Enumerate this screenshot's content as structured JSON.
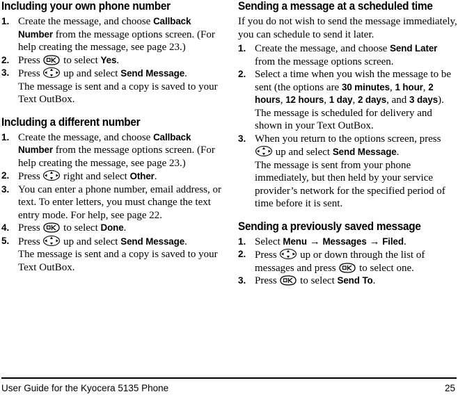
{
  "document": {
    "title": "User Guide for the Kyocera 5135 Phone",
    "page_number": "25"
  },
  "icons": {
    "ok_key": "ok-key-icon",
    "nav_key": "navigation-key-icon",
    "arrow": "→"
  },
  "left_column": {
    "section1": {
      "heading": "Including your own phone number",
      "steps": [
        {
          "num": "1.",
          "parts": [
            {
              "t": "Create the message, and choose ",
              "b": false
            },
            {
              "t": "Callback Number",
              "b": true
            },
            {
              "t": " from the message options screen. (For help creating the message, see page 23.)",
              "b": false
            }
          ]
        },
        {
          "num": "2.",
          "parts": [
            {
              "t": "Press ",
              "b": false
            },
            {
              "t": "",
              "icon": "ok"
            },
            {
              "t": " to select ",
              "b": false
            },
            {
              "t": "Yes",
              "b": true
            },
            {
              "t": ".",
              "b": false
            }
          ]
        },
        {
          "num": "3.",
          "parts": [
            {
              "t": "Press ",
              "b": false
            },
            {
              "t": "",
              "icon": "nav"
            },
            {
              "t": " up and select ",
              "b": false
            },
            {
              "t": "Send Message",
              "b": true
            },
            {
              "t": ".",
              "b": false
            }
          ],
          "sub": "The message is sent and a copy is saved to your Text OutBox."
        }
      ]
    },
    "section2": {
      "heading": "Including a different number",
      "steps": [
        {
          "num": "1.",
          "parts": [
            {
              "t": "Create the message, and choose ",
              "b": false
            },
            {
              "t": "Callback Number",
              "b": true
            },
            {
              "t": " from the message options screen. (For help creating the message, see page 23.)",
              "b": false
            }
          ]
        },
        {
          "num": "2.",
          "parts": [
            {
              "t": "Press ",
              "b": false
            },
            {
              "t": "",
              "icon": "nav"
            },
            {
              "t": " right and select ",
              "b": false
            },
            {
              "t": "Other",
              "b": true
            },
            {
              "t": ".",
              "b": false
            }
          ]
        },
        {
          "num": "3.",
          "parts": [
            {
              "t": "You can enter a phone number, email address, or text. To enter letters, you must change the text entry mode. For help, see page 22.",
              "b": false
            }
          ]
        },
        {
          "num": "4.",
          "parts": [
            {
              "t": "Press ",
              "b": false
            },
            {
              "t": "",
              "icon": "ok"
            },
            {
              "t": " to select ",
              "b": false
            },
            {
              "t": "Done",
              "b": true
            },
            {
              "t": ".",
              "b": false
            }
          ]
        },
        {
          "num": "5.",
          "parts": [
            {
              "t": "Press ",
              "b": false
            },
            {
              "t": "",
              "icon": "nav"
            },
            {
              "t": " up and select ",
              "b": false
            },
            {
              "t": "Send Message",
              "b": true
            },
            {
              "t": ".",
              "b": false
            }
          ],
          "sub": "The message is sent and a copy is saved to your Text OutBox."
        }
      ]
    }
  },
  "right_column": {
    "section1": {
      "heading": "Sending a message at a scheduled time",
      "intro": "If you do not wish to send the message immediately, you can schedule to send it later.",
      "steps": [
        {
          "num": "1.",
          "parts": [
            {
              "t": "Create the message, and choose ",
              "b": false
            },
            {
              "t": "Send Later",
              "b": true
            },
            {
              "t": " from the message options screen.",
              "b": false
            }
          ]
        },
        {
          "num": "2.",
          "parts": [
            {
              "t": "Select a time when you wish the message to be sent (the options are ",
              "b": false
            },
            {
              "t": "30 minutes",
              "b": true
            },
            {
              "t": ", ",
              "b": false
            },
            {
              "t": "1 hour",
              "b": true
            },
            {
              "t": ", ",
              "b": false
            },
            {
              "t": "2 hours",
              "b": true
            },
            {
              "t": ", ",
              "b": false
            },
            {
              "t": "12 hours",
              "b": true
            },
            {
              "t": ", ",
              "b": false
            },
            {
              "t": "1 day",
              "b": true
            },
            {
              "t": ", ",
              "b": false
            },
            {
              "t": "2 days",
              "b": true
            },
            {
              "t": ", and ",
              "b": false
            },
            {
              "t": "3 days",
              "b": true
            },
            {
              "t": ").",
              "b": false
            }
          ],
          "sub": "The message is scheduled for delivery and shown in your Text OutBox."
        },
        {
          "num": "3.",
          "parts": [
            {
              "t": "When you return to the options screen, press ",
              "b": false
            },
            {
              "t": "",
              "icon": "nav"
            },
            {
              "t": " up and select ",
              "b": false
            },
            {
              "t": "Send Message",
              "b": true
            },
            {
              "t": ".",
              "b": false
            }
          ],
          "sub": "The message is sent from your phone immediately, but then held by your service provider’s network for the specified period of time before it is sent."
        }
      ]
    },
    "section2": {
      "heading": "Sending a previously saved message",
      "steps": [
        {
          "num": "1.",
          "parts": [
            {
              "t": "Select ",
              "b": false
            },
            {
              "t": "Menu",
              "b": true
            },
            {
              "t": " → ",
              "arrow": true
            },
            {
              "t": "Messages",
              "b": true
            },
            {
              "t": " → ",
              "arrow": true
            },
            {
              "t": "Filed",
              "b": true
            },
            {
              "t": ".",
              "b": false
            }
          ]
        },
        {
          "num": "2.",
          "parts": [
            {
              "t": "Press ",
              "b": false
            },
            {
              "t": "",
              "icon": "nav"
            },
            {
              "t": " up or down through the list of messages and press ",
              "b": false
            },
            {
              "t": "",
              "icon": "ok"
            },
            {
              "t": " to select one.",
              "b": false
            }
          ]
        },
        {
          "num": "3.",
          "parts": [
            {
              "t": "Press ",
              "b": false
            },
            {
              "t": "",
              "icon": "ok"
            },
            {
              "t": " to select ",
              "b": false
            },
            {
              "t": "Send To",
              "b": true
            },
            {
              "t": ".",
              "b": false
            }
          ]
        }
      ]
    }
  }
}
